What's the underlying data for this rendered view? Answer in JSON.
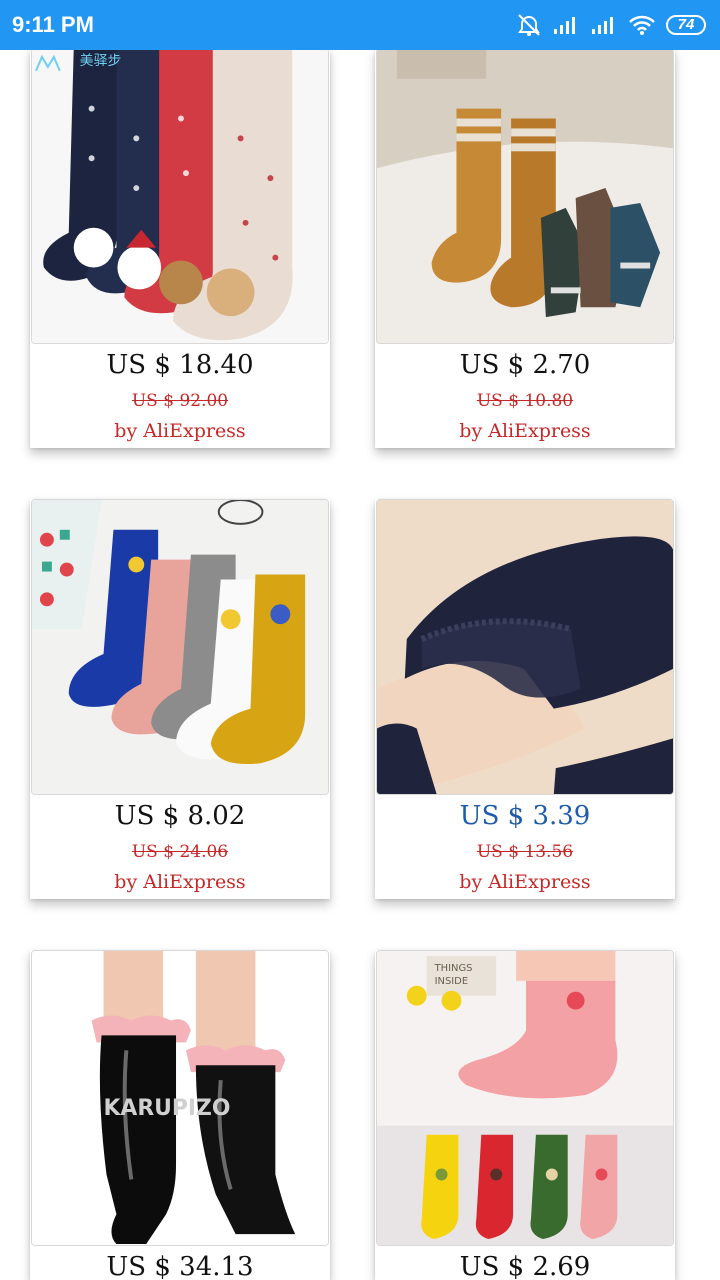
{
  "status_bar": {
    "time": "9:11 PM",
    "battery": "74",
    "icons": [
      "alarm-off-icon",
      "signal-icon",
      "signal-icon",
      "wifi-icon",
      "battery-icon"
    ]
  },
  "products": [
    {
      "price": "US $ 18.40",
      "old_price": "US $ 92.00",
      "seller": "by AliExpress",
      "image": "christmas-socks-image",
      "watermark": "美驿步"
    },
    {
      "price": "US $ 2.70",
      "old_price": "US $ 10.80",
      "seller": "by AliExpress",
      "image": "wool-socks-image"
    },
    {
      "price": "US $ 8.02",
      "old_price": "US $ 24.06",
      "seller": "by AliExpress",
      "image": "colorful-socks-image"
    },
    {
      "price": "US $ 3.39",
      "old_price": "US $ 13.56",
      "seller": "by AliExpress",
      "image": "lace-stockings-image",
      "price_color": "#1e5ba8"
    },
    {
      "price": "US $ 34.13",
      "old_price": "",
      "seller": "",
      "image": "black-ruffle-socks-image",
      "watermark": "KARUPIZO"
    },
    {
      "price": "US $ 2.69",
      "old_price": "",
      "seller": "",
      "image": "pink-fruit-socks-image",
      "sign_text": "THINGS\nINSIDE"
    }
  ],
  "colors": {
    "status_bar": "#2196f3",
    "old_price": "#c62828",
    "seller": "#c62828",
    "link_price": "#1e5ba8"
  }
}
